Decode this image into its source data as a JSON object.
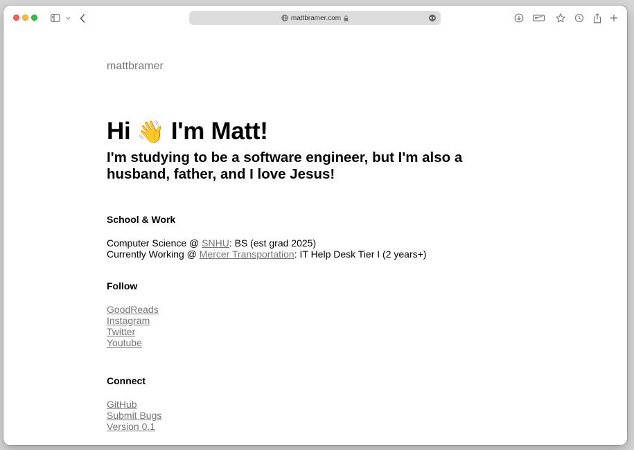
{
  "browser": {
    "url": "mattbramer.com",
    "toolbar_icons": [
      "sidebar-icon",
      "chevron-down-icon",
      "back-icon",
      "download-icon",
      "reader-icon",
      "star-icon",
      "history-icon",
      "share-icon",
      "new-tab-icon"
    ]
  },
  "site": {
    "name": "mattbramer",
    "hero_pre": "Hi",
    "hero_emoji": "👋",
    "hero_post": "I'm Matt!",
    "tagline": "I'm studying to be a software engineer, but I'm also a husband, father, and I love Jesus!"
  },
  "school_work": {
    "heading": "School & Work",
    "line1_prefix": "Computer Science @ ",
    "line1_link": "SNHU",
    "line1_suffix": ": BS (est grad 2025)",
    "line2_prefix": "Currently Working @ ",
    "line2_link": "Mercer Transportation",
    "line2_suffix": ": IT Help Desk Tier I (2 years+)"
  },
  "follow": {
    "heading": "Follow",
    "links": [
      "GoodReads",
      "Instagram",
      "Twitter",
      "Youtube"
    ]
  },
  "connect": {
    "heading": "Connect",
    "links": [
      "GitHub",
      "Submit Bugs",
      "Version 0.1"
    ]
  },
  "colors": {
    "link": "#757575",
    "text": "#000000",
    "address_bar": "#dcdcdc"
  }
}
